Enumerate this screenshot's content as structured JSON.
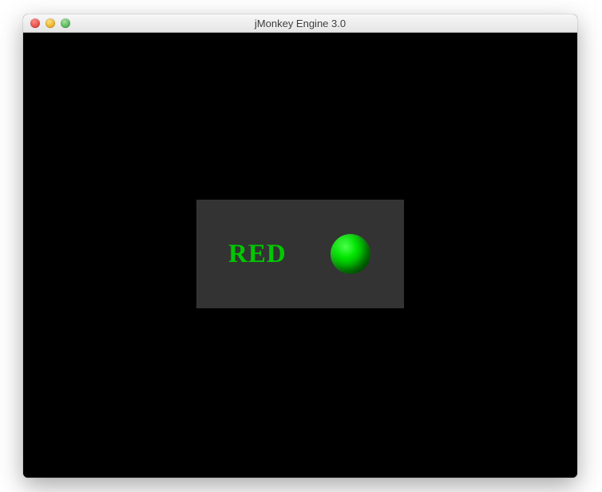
{
  "window": {
    "title": "jMonkey Engine 3.0"
  },
  "panel": {
    "label": "RED"
  },
  "colors": {
    "panel_bg": "#333333",
    "text": "#00c800",
    "sphere": "#00e600",
    "content_bg": "#000000"
  }
}
